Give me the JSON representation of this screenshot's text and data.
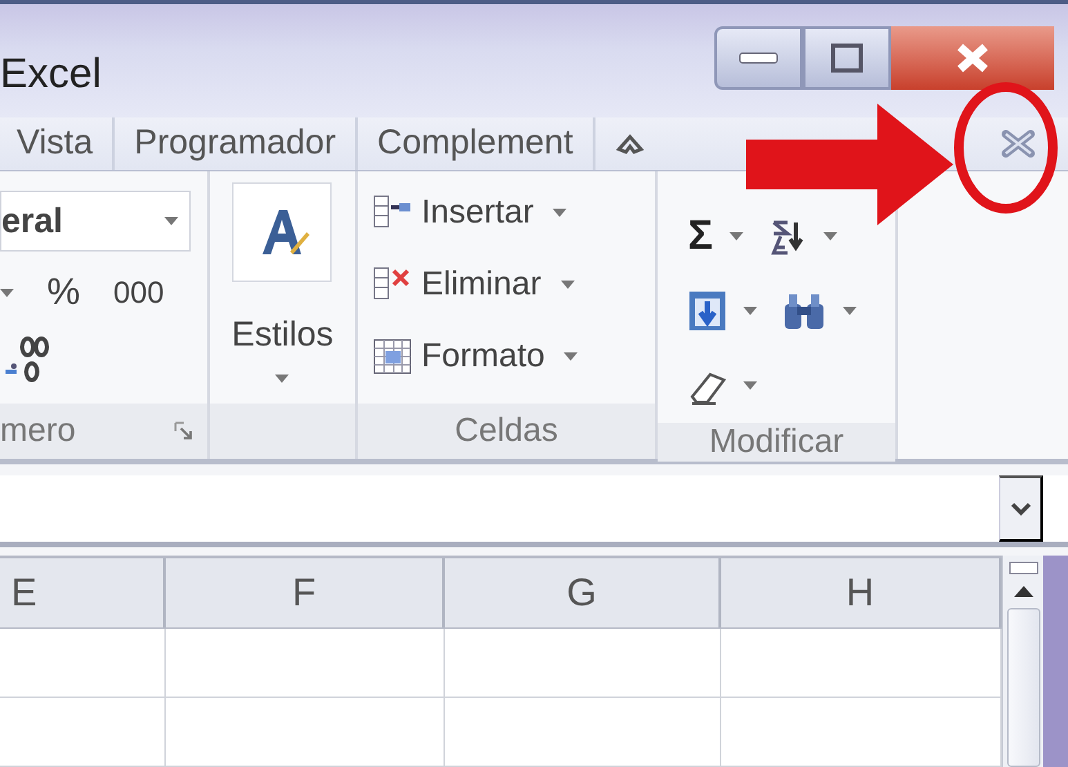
{
  "window": {
    "title": "Excel"
  },
  "ribbon_tabs": [
    {
      "label": "Vista",
      "selected": false
    },
    {
      "label": "Programador",
      "selected": false
    },
    {
      "label": "Complement",
      "selected": false
    }
  ],
  "groups": [
    {
      "kind": "number",
      "label": "mero",
      "format": "eral",
      "buttons": [
        "%",
        "000"
      ]
    },
    {
      "kind": "styles",
      "button": "Estilos"
    },
    {
      "kind": "cells",
      "label": "Celdas",
      "commands": [
        "Insertar",
        "Eliminar",
        "Formato"
      ]
    },
    {
      "kind": "editing",
      "label": "Modificar",
      "sum": "Σ"
    }
  ],
  "columns": [
    "E",
    "F",
    "G",
    "H"
  ]
}
